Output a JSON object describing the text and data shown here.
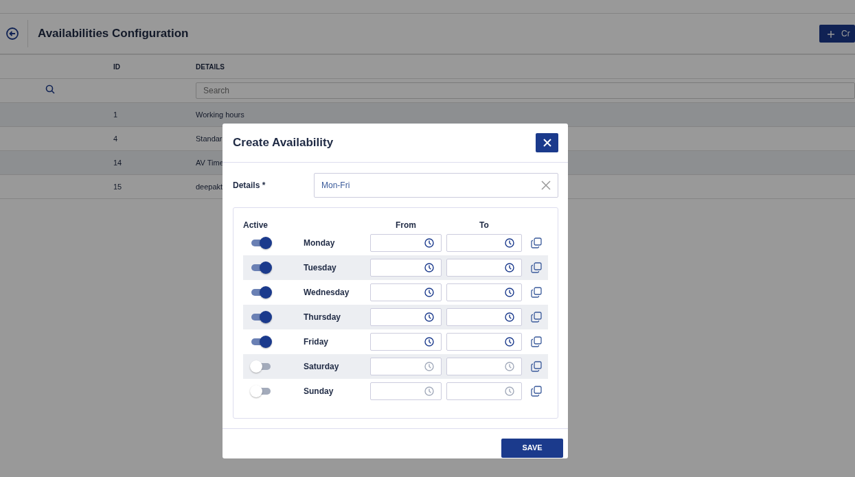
{
  "page": {
    "title": "Availabilities Configuration",
    "create_button": "Cr"
  },
  "table": {
    "columns": [
      "ID",
      "DETAILS"
    ],
    "search": {
      "placeholder": "Search"
    },
    "rows": [
      {
        "id": "1",
        "details": "Working hours"
      },
      {
        "id": "4",
        "details": "Standar"
      },
      {
        "id": "14",
        "details": "AV Time"
      },
      {
        "id": "15",
        "details": "deepakt"
      }
    ]
  },
  "dialog": {
    "title": "Create Availability",
    "details_label": "Details *",
    "details_value": "Mon-Fri",
    "headers": {
      "active": "Active",
      "from": "From",
      "to": "To"
    },
    "days": [
      {
        "name": "Monday",
        "active": true
      },
      {
        "name": "Tuesday",
        "active": true
      },
      {
        "name": "Wednesday",
        "active": true
      },
      {
        "name": "Thursday",
        "active": true
      },
      {
        "name": "Friday",
        "active": true
      },
      {
        "name": "Saturday",
        "active": false
      },
      {
        "name": "Sunday",
        "active": false
      }
    ],
    "save_button": "SAVE"
  }
}
